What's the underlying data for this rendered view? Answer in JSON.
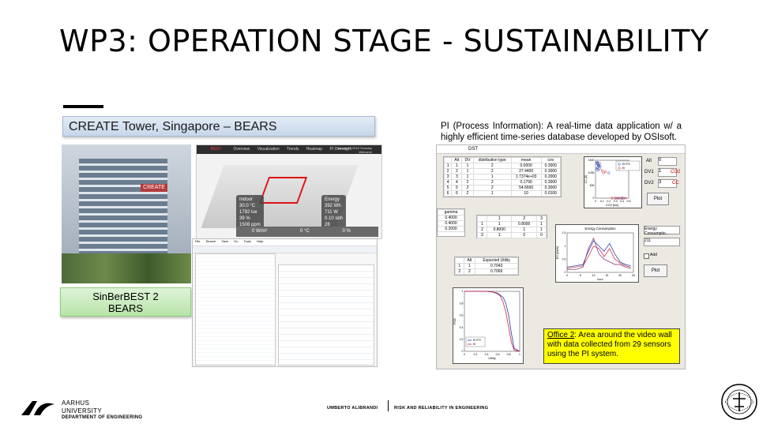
{
  "slide": {
    "title": "WP3: OPERATION STAGE - SUSTAINABILITY",
    "create_banner": "CREATE Tower, Singapore – BEARS",
    "sinber_line1": "SinBerBEST 2",
    "sinber_line2": "BEARS",
    "pi_description": "PI (Process Information): A real-time data application w/ a highly efficient time-series database developed by OSIsoft.",
    "office_note_label": "Office 2",
    "office_note_text": ": Area around the video wall with data collected from 29 sensors using the PI system."
  },
  "bears_screenshot": {
    "logo": "BEST",
    "nav_items": [
      "Overview",
      "Visualization",
      "Trends",
      "Heatmap",
      "PI Oversight"
    ],
    "date": "January 9 2018 Tuesday",
    "welcome": "Welcome",
    "indoor_title": "Indoor",
    "indoor_values": [
      "30.0 °C",
      "1792 lux",
      "39 %",
      "1508 ppm"
    ],
    "energy_title": "Energy",
    "energy_values": [
      "392 Wh",
      "711 W",
      "0.10 sbh",
      "28"
    ],
    "bottom_values": [
      "0 W/m²",
      "0 °C",
      "0 %"
    ]
  },
  "pi_screenshot": {
    "menu_items": [
      "File",
      "Search",
      "View",
      "Go",
      "Tools",
      "Help"
    ]
  },
  "dst_window": {
    "title": "DST",
    "table_headers": [
      "Alt",
      "DV",
      "distribution type",
      "mean",
      "cov"
    ],
    "table_rows": [
      [
        "1",
        "1",
        "2",
        "0.0000",
        "0.3000"
      ],
      [
        "2",
        "1",
        "2",
        "27.4400",
        "0.3000"
      ],
      [
        "3",
        "1",
        "1",
        "1.7374e+03",
        "0.2000"
      ],
      [
        "4",
        "2",
        "2",
        "0.1790",
        "0.3000"
      ],
      [
        "5",
        "2",
        "2",
        "54.6600",
        "0.3000"
      ],
      [
        "6",
        "2",
        "1",
        "10",
        "0.0100"
      ]
    ],
    "gamma_header": "gamma",
    "gamma_values": [
      "0.4000",
      "0.4000",
      "0.2000"
    ],
    "mini_headers": [
      "1",
      "2",
      "3"
    ],
    "mini_rows": [
      [
        "1",
        "0.8000",
        "1"
      ],
      [
        "0.8000",
        "1",
        "1"
      ],
      [
        "1",
        "0",
        "0"
      ]
    ],
    "utility_headers": [
      "Alt",
      "Expected Utility"
    ],
    "utility_rows": [
      [
        "1",
        "0.7043"
      ],
      [
        "2",
        "0.7069"
      ]
    ],
    "scatter_legend": [
      "EI+PV",
      "EI"
    ],
    "scatter_xlabel": "CO2 [ton]",
    "scatter_ylabel": "CC [$]",
    "energy_title": "Energy Consumption",
    "energy_xlabel": "hour",
    "energy_ylabel": "EC [kWh]",
    "poe_legend": [
      "EI+PV",
      "EI"
    ],
    "poe_xlabel": "Utility",
    "poe_ylabel": "POE",
    "controls": {
      "alt_label": "Alt",
      "alt_value": "0",
      "dv1_label": "DV1",
      "dv1_value": "1",
      "dv2_label": "DV2",
      "dv2_value": "3",
      "co2_label": "CO2",
      "cc_label": "CC",
      "plot_button": "Plot",
      "energy_select": "Energy Consumptio...",
      "room_select": "211",
      "add_label": "Add",
      "plot2_button": "Plot"
    },
    "colors": {
      "ei_pv": "#2233aa",
      "ei": "#cc2233"
    }
  },
  "footer": {
    "university_line1": "AARHUS",
    "university_line2": "UNIVERSITY",
    "department": "DEPARTMENT OF ENGINEERING",
    "author": "UMBERTO ALIBRANDI",
    "course": "RISK AND RELIABILITY IN ENGINEERING"
  },
  "chart_data": [
    {
      "type": "scatter",
      "xlabel": "CO2 [ton]",
      "ylabel": "CC [$]",
      "xlim": [
        0,
        0.5
      ],
      "ylim": [
        0,
        1500
      ],
      "xticks": [
        "0",
        "0.1",
        "0.2",
        "0.3",
        "0.4",
        "0.5"
      ],
      "yticks": [
        "0",
        "500",
        "1000",
        "1500"
      ],
      "series": [
        {
          "name": "EI+PV",
          "points": [
            [
              0.02,
              1400
            ],
            [
              0.03,
              1350
            ],
            [
              0.04,
              1300
            ],
            [
              0.05,
              1250
            ],
            [
              0.03,
              1200
            ],
            [
              0.02,
              1150
            ],
            [
              0.06,
              1380
            ],
            [
              0.04,
              1100
            ],
            [
              0.05,
              1320
            ],
            [
              0.07,
              1260
            ],
            [
              0.03,
              1420
            ],
            [
              0.06,
              1180
            ],
            [
              0.2,
              1000
            ],
            [
              0.3,
              0
            ],
            [
              0.35,
              0
            ],
            [
              0.4,
              0
            ]
          ]
        },
        {
          "name": "EI",
          "points": [
            [
              0.1,
              1100
            ],
            [
              0.12,
              1000
            ],
            [
              0.15,
              1050
            ],
            [
              0.25,
              0
            ],
            [
              0.3,
              0
            ],
            [
              0.33,
              0
            ],
            [
              0.38,
              0
            ],
            [
              0.42,
              0
            ],
            [
              0.45,
              0
            ]
          ]
        }
      ]
    },
    {
      "type": "line",
      "title": "Energy Consumption",
      "xlabel": "hour",
      "ylabel": "EC [kWh]",
      "xlim": [
        0,
        25
      ],
      "ylim": [
        0,
        1.5
      ],
      "xticks": [
        "0",
        "5",
        "10",
        "15",
        "20",
        "25"
      ],
      "yticks": [
        "0",
        "0.5",
        "1",
        "1.5"
      ],
      "series": [
        {
          "x": [
            0,
            3,
            6,
            8,
            10,
            12,
            14,
            16,
            18,
            20,
            22,
            24
          ],
          "values": [
            0.2,
            0.25,
            0.3,
            0.8,
            1.2,
            1.0,
            0.8,
            1.1,
            0.7,
            0.4,
            0.3,
            0.25
          ]
        },
        {
          "x": [
            0,
            3,
            6,
            8,
            10,
            12,
            14,
            16,
            18,
            20,
            22,
            24
          ],
          "values": [
            0.15,
            0.2,
            0.25,
            0.6,
            1.0,
            0.9,
            0.6,
            0.9,
            0.5,
            0.35,
            0.25,
            0.2
          ]
        },
        {
          "x": [
            0,
            3,
            6,
            8,
            10,
            12,
            14,
            16,
            18,
            20,
            22,
            24
          ],
          "values": [
            0.1,
            0.1,
            0.2,
            0.9,
            1.3,
            0.7,
            0.5,
            0.4,
            0.3,
            0.3,
            0.2,
            0.15
          ]
        }
      ]
    },
    {
      "type": "line",
      "xlabel": "Utility",
      "ylabel": "POE",
      "xlim": [
        0,
        1
      ],
      "ylim": [
        0,
        1
      ],
      "xticks": [
        "0",
        "0.2",
        "0.4",
        "0.6",
        "0.8",
        "1"
      ],
      "yticks": [
        "0",
        "0.2",
        "0.4",
        "0.6",
        "0.8",
        "1"
      ],
      "series": [
        {
          "name": "EI+PV",
          "x": [
            0,
            0.2,
            0.4,
            0.5,
            0.6,
            0.7,
            0.75,
            0.8,
            0.85,
            0.9,
            1
          ],
          "values": [
            1,
            1,
            1,
            0.99,
            0.97,
            0.9,
            0.8,
            0.6,
            0.3,
            0.05,
            0
          ]
        },
        {
          "name": "EI",
          "x": [
            0,
            0.2,
            0.4,
            0.5,
            0.6,
            0.65,
            0.7,
            0.75,
            0.8,
            0.85,
            0.9,
            1
          ],
          "values": [
            1,
            1,
            1,
            0.99,
            0.96,
            0.92,
            0.82,
            0.65,
            0.4,
            0.15,
            0.02,
            0
          ]
        }
      ]
    }
  ]
}
